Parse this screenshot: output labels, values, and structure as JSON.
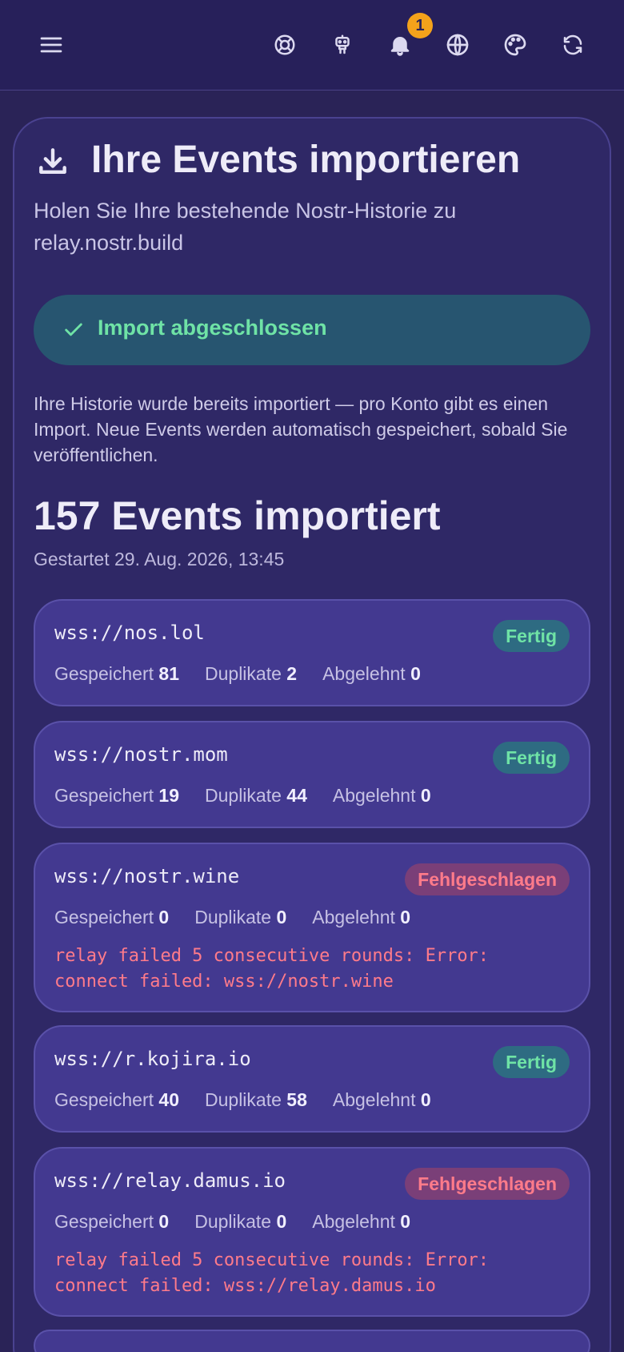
{
  "topbar": {
    "menu_icon": "menu-icon",
    "icons": [
      "lifebuoy-icon",
      "robot-icon",
      "bell-icon",
      "globe-icon",
      "palette-icon",
      "refresh-icon"
    ],
    "notification_count": "1"
  },
  "header": {
    "icon": "download-icon",
    "title": "Ihre Events importieren",
    "subtitle": "Holen Sie Ihre bestehende Nostr-Historie zu relay.nostr.build"
  },
  "status": {
    "icon": "check-icon",
    "label": "Import abgeschlossen",
    "description": "Ihre Historie wurde bereits importiert — pro Konto gibt es einen Import. Neue Events werden automatisch gespeichert, sobald Sie veröffentlichen."
  },
  "summary": {
    "total": "157 Events importiert",
    "started": "Gestartet 29. Aug. 2026, 13:45"
  },
  "labels": {
    "saved": "Gespeichert",
    "duplicates": "Duplikate",
    "rejected": "Abgelehnt"
  },
  "relays": [
    {
      "url": "wss://nos.lol",
      "status": "Fertig",
      "saved": "81",
      "duplicates": "2",
      "rejected": "0",
      "error": ""
    },
    {
      "url": "wss://nostr.mom",
      "status": "Fertig",
      "saved": "19",
      "duplicates": "44",
      "rejected": "0",
      "error": ""
    },
    {
      "url": "wss://nostr.wine",
      "status": "Fehlgeschlagen",
      "saved": "0",
      "duplicates": "0",
      "rejected": "0",
      "error": "relay failed 5 consecutive rounds: Error: connect failed: wss://nostr.wine"
    },
    {
      "url": "wss://r.kojira.io",
      "status": "Fertig",
      "saved": "40",
      "duplicates": "58",
      "rejected": "0",
      "error": ""
    },
    {
      "url": "wss://relay.damus.io",
      "status": "Fehlgeschlagen",
      "saved": "0",
      "duplicates": "0",
      "rejected": "0",
      "error": "relay failed 5 consecutive rounds: Error: connect failed: wss://relay.damus.io"
    }
  ],
  "colors": {
    "background": "#2a2357",
    "card": "#433990",
    "success": "#6fe3a6",
    "error": "#ff7b8a",
    "badge": "#f4a21b"
  }
}
